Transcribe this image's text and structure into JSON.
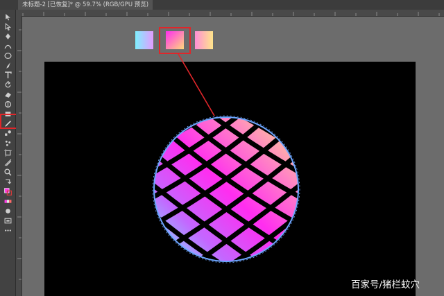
{
  "document_tab": {
    "title": "未标题-2 [已恢复]* @ 59.7% (RGB/GPU 预览)"
  },
  "tools": [
    {
      "icon": "selection-arrow-icon"
    },
    {
      "icon": "direct-selection-icon"
    },
    {
      "icon": "pen-icon"
    },
    {
      "icon": "curvature-icon"
    },
    {
      "icon": "ellipse-icon"
    },
    {
      "icon": "paintbrush-icon"
    },
    {
      "icon": "type-icon"
    },
    {
      "icon": "rotate-icon"
    },
    {
      "icon": "eraser-icon"
    },
    {
      "icon": "warp-icon"
    },
    {
      "icon": "rectangle-icon"
    },
    {
      "icon": "eyedropper-icon"
    },
    {
      "icon": "blend-icon"
    },
    {
      "icon": "symbol-sprayer-icon"
    },
    {
      "icon": "artboard-icon"
    },
    {
      "icon": "slice-icon"
    },
    {
      "icon": "zoom-icon"
    },
    {
      "icon": "swap-colors-icon"
    },
    {
      "icon": "fill-stroke-icon"
    },
    {
      "icon": "color-mode-icon"
    },
    {
      "icon": "draw-mode-icon"
    },
    {
      "icon": "screen-mode-icon"
    },
    {
      "icon": "more-tools-icon"
    }
  ],
  "swatches": [
    {
      "name": "cyan-pink",
      "from": "#7ef0ff",
      "to": "#e39bff"
    },
    {
      "name": "magenta-yellow",
      "from": "#ff2df0",
      "to": "#ffd97a"
    },
    {
      "name": "pink-yellow",
      "from": "#ff8fd6",
      "to": "#ffe58a"
    }
  ],
  "colors": {
    "highlight": "#e0262a",
    "artboard": "#000000",
    "canvas": "#6c6c6c"
  },
  "watermark": "百家号/猪栏蚊穴"
}
